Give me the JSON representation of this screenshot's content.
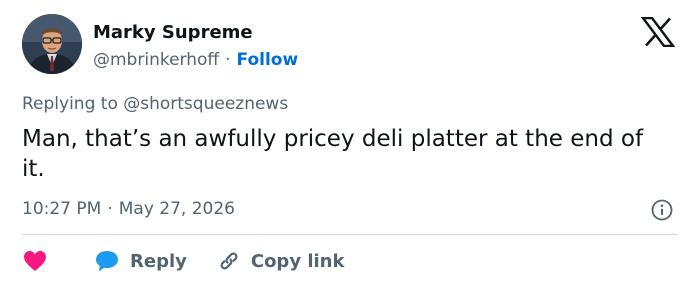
{
  "author": {
    "name": "Marky Supreme",
    "handle": "@mbrinkerhoff",
    "separator": "·",
    "follow_label": "Follow"
  },
  "reply_context": {
    "prefix": "Replying to",
    "mention": "@shortsqueeznews"
  },
  "tweet": {
    "text": "Man, that’s an awfully pricey deli platter at the end of it.",
    "time": "10:27 PM",
    "separator": "·",
    "date": "May 27, 2026"
  },
  "actions": {
    "reply_label": "Reply",
    "copy_link_label": "Copy link"
  },
  "icons": {
    "brand": "x-logo-icon",
    "info": "info-icon",
    "like": "heart-icon",
    "reply": "speech-bubble-icon",
    "copy": "link-icon"
  },
  "colors": {
    "text_primary": "#0f1419",
    "text_secondary": "#536471",
    "follow_link": "#006fd6",
    "heart": "#f91880",
    "reply_bubble": "#1d9bf0",
    "divider": "#cfd9de"
  }
}
